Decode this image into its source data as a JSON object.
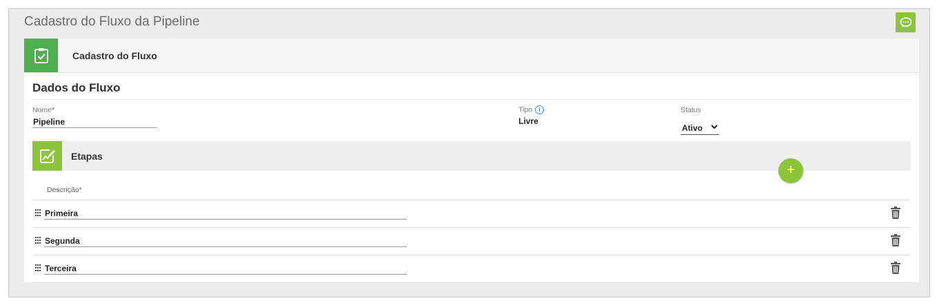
{
  "page": {
    "title": "Cadastro do Fluxo da Pipeline"
  },
  "panel": {
    "header_label": "Cadastro do Fluxo"
  },
  "dados": {
    "title": "Dados do Fluxo",
    "nome": {
      "label": "Nome*",
      "value": "Pipeline"
    },
    "tipo": {
      "label": "Tipo",
      "value": "Livre"
    },
    "status": {
      "label": "Status",
      "value": "Ativo"
    }
  },
  "etapas": {
    "title": "Etapas",
    "add_label": "+",
    "column_header": "Descrição*",
    "steps": [
      {
        "value": "Primeira"
      },
      {
        "value": "Segunda"
      },
      {
        "value": "Terceira"
      }
    ]
  },
  "colors": {
    "accent_green": "#4caf50",
    "light_green": "#8cc43c",
    "info_blue": "#3d8fd8"
  }
}
